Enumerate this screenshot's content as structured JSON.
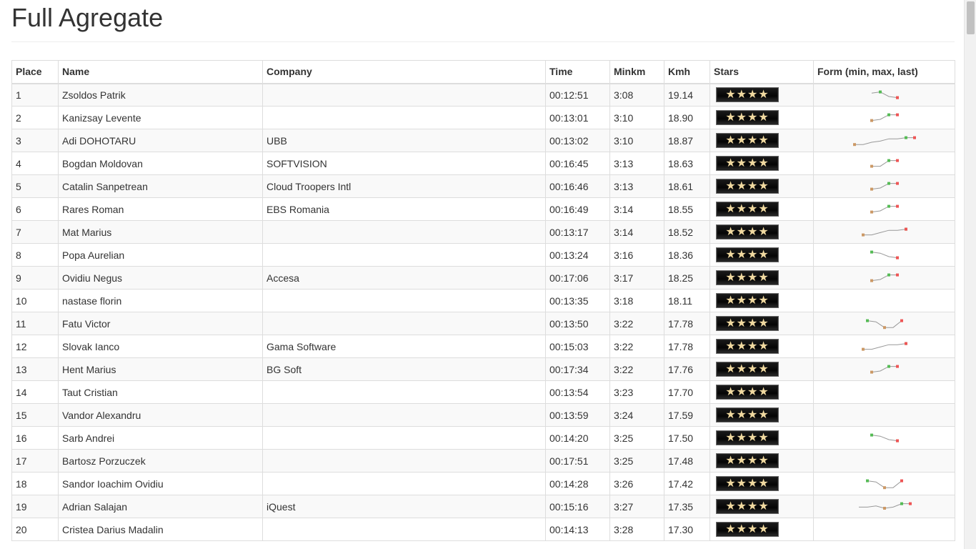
{
  "page": {
    "title": "Full Agregate"
  },
  "table": {
    "headers": [
      "Place",
      "Name",
      "Company",
      "Time",
      "Minkm",
      "Kmh",
      "Stars",
      "Form (min, max, last)"
    ],
    "rows": [
      {
        "place": "1",
        "name": "Zsoldos Patrik",
        "company": "",
        "time": "00:12:51",
        "minkm": "3:08",
        "kmh": "19.14",
        "stars": "★★★★",
        "form": [
          3,
          2,
          6,
          7
        ]
      },
      {
        "place": "2",
        "name": "Kanizsay Levente",
        "company": "",
        "time": "00:13:01",
        "minkm": "3:10",
        "kmh": "18.90",
        "stars": "★★★★",
        "form": [
          7,
          6,
          2,
          2
        ]
      },
      {
        "place": "3",
        "name": "Adi DOHOTARU",
        "company": "UBB",
        "time": "00:13:02",
        "minkm": "3:10",
        "kmh": "18.87",
        "stars": "★★★★",
        "form": [
          8,
          8,
          6,
          5,
          3,
          3,
          2,
          2
        ]
      },
      {
        "place": "4",
        "name": "Bogdan Moldovan",
        "company": "SOFTVISION",
        "time": "00:16:45",
        "minkm": "3:13",
        "kmh": "18.63",
        "stars": "★★★★",
        "form": [
          7,
          7,
          2,
          2
        ]
      },
      {
        "place": "5",
        "name": "Catalin Sanpetrean",
        "company": "Cloud Troopers Intl",
        "time": "00:16:46",
        "minkm": "3:13",
        "kmh": "18.61",
        "stars": "★★★★",
        "form": [
          7,
          6,
          2,
          2
        ]
      },
      {
        "place": "6",
        "name": "Rares Roman",
        "company": "EBS Romania",
        "time": "00:16:49",
        "minkm": "3:14",
        "kmh": "18.55",
        "stars": "★★★★",
        "form": [
          7,
          6,
          2,
          2
        ]
      },
      {
        "place": "7",
        "name": "Mat Marius",
        "company": "",
        "time": "00:13:17",
        "minkm": "3:14",
        "kmh": "18.52",
        "stars": "★★★★",
        "form": [
          7,
          7,
          5,
          3,
          3,
          2
        ]
      },
      {
        "place": "8",
        "name": "Popa Aurelian",
        "company": "",
        "time": "00:13:24",
        "minkm": "3:16",
        "kmh": "18.36",
        "stars": "★★★★",
        "form": [
          2,
          3,
          6,
          7
        ]
      },
      {
        "place": "9",
        "name": "Ovidiu Negus",
        "company": "Accesa",
        "time": "00:17:06",
        "minkm": "3:17",
        "kmh": "18.25",
        "stars": "★★★★",
        "form": [
          7,
          6,
          2,
          2
        ]
      },
      {
        "place": "10",
        "name": "nastase florin",
        "company": "",
        "time": "00:13:35",
        "minkm": "3:18",
        "kmh": "18.11",
        "stars": "★★★★",
        "form": []
      },
      {
        "place": "11",
        "name": "Fatu Victor",
        "company": "",
        "time": "00:13:50",
        "minkm": "3:22",
        "kmh": "17.78",
        "stars": "★★★★",
        "form": [
          2,
          3,
          8,
          8,
          2
        ]
      },
      {
        "place": "12",
        "name": "Slovak Ianco",
        "company": "Gama Software",
        "time": "00:15:03",
        "minkm": "3:22",
        "kmh": "17.78",
        "stars": "★★★★",
        "form": [
          7,
          7,
          5,
          3,
          3,
          2
        ]
      },
      {
        "place": "13",
        "name": "Hent Marius",
        "company": "BG Soft",
        "time": "00:17:34",
        "minkm": "3:22",
        "kmh": "17.76",
        "stars": "★★★★",
        "form": [
          7,
          6,
          2,
          2
        ]
      },
      {
        "place": "14",
        "name": "Taut Cristian",
        "company": "",
        "time": "00:13:54",
        "minkm": "3:23",
        "kmh": "17.70",
        "stars": "★★★★",
        "form": []
      },
      {
        "place": "15",
        "name": "Vandor Alexandru",
        "company": "",
        "time": "00:13:59",
        "minkm": "3:24",
        "kmh": "17.59",
        "stars": "★★★★",
        "form": []
      },
      {
        "place": "16",
        "name": "Sarb Andrei",
        "company": "",
        "time": "00:14:20",
        "minkm": "3:25",
        "kmh": "17.50",
        "stars": "★★★★",
        "form": [
          2,
          3,
          6,
          7
        ]
      },
      {
        "place": "17",
        "name": "Bartosz Porzuczek",
        "company": "",
        "time": "00:17:51",
        "minkm": "3:25",
        "kmh": "17.48",
        "stars": "★★★★",
        "form": []
      },
      {
        "place": "18",
        "name": "Sandor Ioachim Ovidiu",
        "company": "",
        "time": "00:14:28",
        "minkm": "3:26",
        "kmh": "17.42",
        "stars": "★★★★",
        "form": [
          2,
          3,
          8,
          8,
          2
        ]
      },
      {
        "place": "19",
        "name": "Adrian Salajan",
        "company": "iQuest",
        "time": "00:15:16",
        "minkm": "3:27",
        "kmh": "17.35",
        "stars": "★★★★",
        "form": [
          5,
          5,
          4,
          6,
          5,
          2,
          2
        ]
      },
      {
        "place": "20",
        "name": "Cristea Darius Madalin",
        "company": "",
        "time": "00:14:13",
        "minkm": "3:28",
        "kmh": "17.30",
        "stars": "★★★★",
        "form": []
      }
    ]
  },
  "sparkline_colors": {
    "line": "#999999",
    "min": "#cc9966",
    "max": "#55bb55",
    "last": "#ee5555"
  }
}
